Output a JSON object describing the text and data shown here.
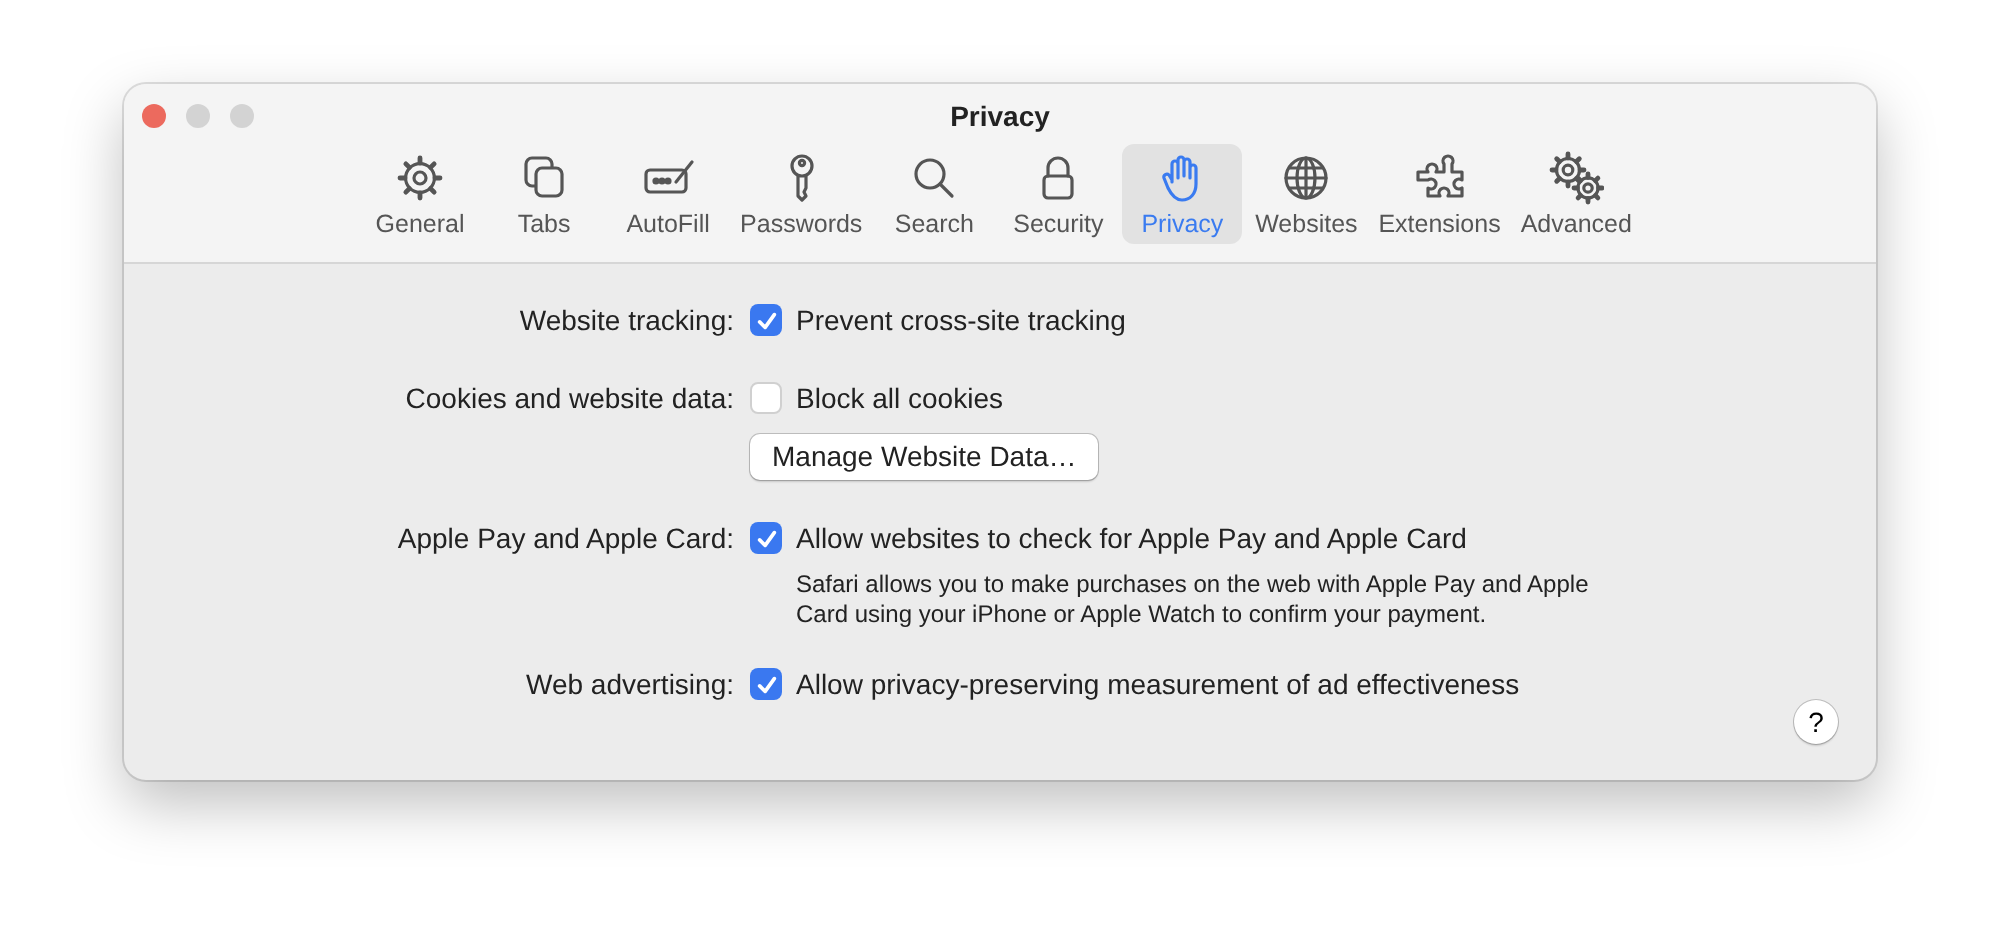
{
  "window": {
    "title": "Privacy"
  },
  "tabs": [
    {
      "label": "General",
      "kind": "gear",
      "selected": false
    },
    {
      "label": "Tabs",
      "kind": "tabs",
      "selected": false
    },
    {
      "label": "AutoFill",
      "kind": "autofill",
      "selected": false
    },
    {
      "label": "Passwords",
      "kind": "key",
      "selected": false
    },
    {
      "label": "Search",
      "kind": "search",
      "selected": false
    },
    {
      "label": "Security",
      "kind": "lock",
      "selected": false
    },
    {
      "label": "Privacy",
      "kind": "hand",
      "selected": true
    },
    {
      "label": "Websites",
      "kind": "globe",
      "selected": false
    },
    {
      "label": "Extensions",
      "kind": "puzzle",
      "selected": false
    },
    {
      "label": "Advanced",
      "kind": "gears",
      "selected": false
    }
  ],
  "settings": [
    {
      "label": "Website tracking:",
      "controls": [
        {
          "kind": "checkbox",
          "text": "Prevent cross-site tracking",
          "checked": true
        }
      ]
    },
    {
      "label": "Cookies and website data:",
      "controls": [
        {
          "kind": "checkbox",
          "text": "Block all cookies",
          "checked": false
        },
        {
          "kind": "button",
          "text": "Manage Website Data…"
        }
      ]
    },
    {
      "label": "Apple Pay and Apple Card:",
      "controls": [
        {
          "kind": "checkbox",
          "text": "Allow websites to check for Apple Pay and Apple Card",
          "checked": true
        },
        {
          "kind": "note",
          "text": "Safari allows you to make purchases on the web with Apple Pay and Apple Card using your iPhone or Apple Watch to confirm your payment."
        }
      ]
    },
    {
      "label": "Web advertising:",
      "controls": [
        {
          "kind": "checkbox",
          "text": "Allow privacy-preserving measurement of ad effectiveness",
          "checked": true
        }
      ]
    }
  ],
  "help_button": {
    "text": "?"
  }
}
